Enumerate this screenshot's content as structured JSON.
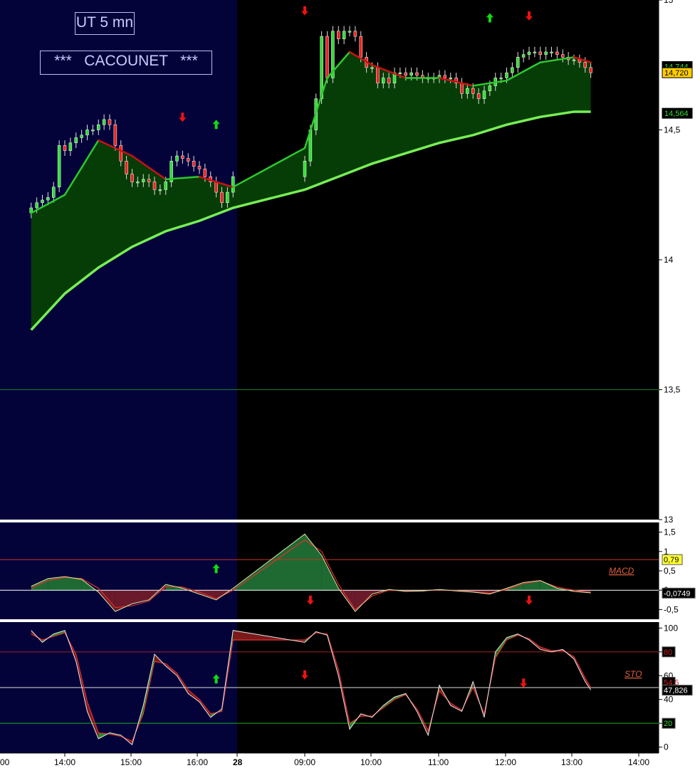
{
  "header": {
    "timeframe": "UT 5 mn",
    "author": "***   CACOUNET   ***"
  },
  "colors": {
    "prev_session_bg": "#03033a",
    "session_bg": "#000000",
    "area_fill": "#063c06",
    "ema_fast_up": "#2ec82e",
    "ema_fast_down": "#cc1111",
    "ema_slow": "#77ee55",
    "candle_up": "#33dd33",
    "candle_down": "#ee2222",
    "signal_up": "#11dd11",
    "signal_down": "#ee1111",
    "ref_line": "#1e7a1e"
  },
  "chart_data": [
    {
      "type": "candlestick",
      "name_shown": "",
      "x_axis": {
        "type": "time",
        "ticks": [
          "14:00",
          "15:00",
          "16:00",
          "28",
          "09:00",
          "10:00",
          "11:00",
          "12:00",
          "13:00",
          "14:00"
        ],
        "left_edge_label": "00"
      },
      "y_axis": {
        "side": "right",
        "range": [
          13.0,
          15.0
        ],
        "ticks": [
          "15",
          "14,5",
          "14",
          "13,5",
          "13"
        ]
      },
      "price_labels": [
        {
          "text": "14,744",
          "value": 14.744,
          "color": "#33dd33"
        },
        {
          "text": "14,720",
          "value": 14.72,
          "color": "#ffcc00"
        },
        {
          "text": "14,564",
          "value": 14.564,
          "color": "#33dd33"
        }
      ],
      "reference_line": 13.5,
      "series": [
        {
          "name": "",
          "role": "close_approx",
          "x": [
            "13:30",
            "13:35",
            "13:40",
            "13:45",
            "13:50",
            "13:55",
            "14:00",
            "14:05",
            "14:10",
            "14:15",
            "14:20",
            "14:25",
            "14:30",
            "14:35",
            "14:40",
            "14:45",
            "14:50",
            "14:55",
            "15:00",
            "15:05",
            "15:10",
            "15:15",
            "15:20",
            "15:25",
            "15:30",
            "15:35",
            "15:40",
            "15:45",
            "15:50",
            "15:55",
            "16:00",
            "16:05",
            "16:10",
            "16:15",
            "16:20",
            "16:25",
            "16:30",
            "09:00",
            "09:05",
            "09:10",
            "09:15",
            "09:20",
            "09:25",
            "09:30",
            "09:35",
            "09:40",
            "09:45",
            "09:50",
            "09:55",
            "10:00",
            "10:05",
            "10:10",
            "10:15",
            "10:20",
            "10:25",
            "10:30",
            "10:35",
            "10:40",
            "10:45",
            "10:50",
            "10:55",
            "11:00",
            "11:05",
            "11:10",
            "11:15",
            "11:20",
            "11:25",
            "11:30",
            "11:35",
            "11:40",
            "11:45",
            "11:50",
            "11:55",
            "12:00",
            "12:05",
            "12:10",
            "12:15",
            "12:20",
            "12:25",
            "12:30",
            "12:35",
            "12:40",
            "12:45",
            "12:50",
            "12:55",
            "13:00",
            "13:05",
            "13:10",
            "13:15"
          ],
          "y": [
            14.2,
            14.22,
            14.23,
            14.24,
            14.28,
            14.44,
            14.42,
            14.45,
            14.47,
            14.48,
            14.5,
            14.5,
            14.52,
            14.54,
            14.52,
            14.44,
            14.38,
            14.33,
            14.3,
            14.3,
            14.31,
            14.3,
            14.27,
            14.27,
            14.3,
            14.38,
            14.4,
            14.39,
            14.38,
            14.36,
            14.35,
            14.32,
            14.3,
            14.26,
            14.22,
            14.26,
            14.32,
            14.38,
            14.5,
            14.62,
            14.86,
            14.7,
            14.88,
            14.85,
            14.88,
            14.88,
            14.86,
            14.78,
            14.74,
            14.74,
            14.68,
            14.7,
            14.68,
            14.72,
            14.72,
            14.71,
            14.72,
            14.71,
            14.7,
            14.7,
            14.7,
            14.71,
            14.7,
            14.7,
            14.68,
            14.64,
            14.66,
            14.64,
            14.62,
            14.65,
            14.67,
            14.7,
            14.7,
            14.72,
            14.74,
            14.78,
            14.79,
            14.8,
            14.8,
            14.79,
            14.8,
            14.8,
            14.79,
            14.78,
            14.77,
            14.77,
            14.76,
            14.74,
            14.72
          ]
        },
        {
          "name": "",
          "role": "ema_fast",
          "x": [
            "13:30",
            "14:00",
            "14:30",
            "15:00",
            "15:30",
            "16:00",
            "16:30",
            "09:00",
            "09:20",
            "09:40",
            "10:00",
            "10:30",
            "11:00",
            "11:30",
            "12:00",
            "12:30",
            "13:00",
            "13:15"
          ],
          "y": [
            14.18,
            14.25,
            14.46,
            14.4,
            14.31,
            14.32,
            14.28,
            14.43,
            14.7,
            14.8,
            14.75,
            14.7,
            14.7,
            14.67,
            14.69,
            14.76,
            14.78,
            14.76
          ]
        },
        {
          "name": "",
          "role": "ema_slow",
          "x": [
            "13:30",
            "14:00",
            "14:30",
            "15:00",
            "15:30",
            "16:00",
            "16:30",
            "09:00",
            "09:30",
            "10:00",
            "10:30",
            "11:00",
            "11:30",
            "12:00",
            "12:30",
            "13:00",
            "13:15"
          ],
          "y": [
            13.73,
            13.87,
            13.97,
            14.05,
            14.11,
            14.15,
            14.2,
            14.27,
            14.32,
            14.37,
            14.41,
            14.45,
            14.48,
            14.52,
            14.55,
            14.57,
            14.57
          ]
        }
      ],
      "signals": [
        {
          "dir": "down",
          "at": "15:45",
          "value": 14.55
        },
        {
          "dir": "up",
          "at": "16:15",
          "value": 14.52
        },
        {
          "dir": "down",
          "at": "09:00",
          "value": 14.96
        },
        {
          "dir": "up",
          "at": "11:45",
          "value": 14.93
        },
        {
          "dir": "down",
          "at": "12:20",
          "value": 14.94
        }
      ]
    },
    {
      "type": "area",
      "title": "MACD",
      "y_axis": {
        "side": "right",
        "range": [
          -0.75,
          1.75
        ],
        "ticks": [
          "1,5",
          "1",
          "0,5",
          "0",
          "-0,5"
        ]
      },
      "levels": [
        0.79,
        0
      ],
      "value_labels": [
        {
          "text": "0,79",
          "value": 0.79,
          "color": "#ffff33"
        },
        {
          "text": "-0,0749",
          "value": -0.0749,
          "color": "#000000"
        }
      ],
      "series": [
        {
          "name": "",
          "role": "macd",
          "x": [
            "13:30",
            "13:45",
            "14:00",
            "14:15",
            "14:30",
            "14:45",
            "15:00",
            "15:15",
            "15:30",
            "15:45",
            "16:00",
            "16:15",
            "16:30",
            "09:00",
            "09:15",
            "09:30",
            "09:45",
            "10:00",
            "10:15",
            "10:30",
            "10:45",
            "11:00",
            "11:15",
            "11:30",
            "11:45",
            "12:00",
            "12:15",
            "12:30",
            "12:45",
            "13:00",
            "13:15"
          ],
          "y": [
            0.1,
            0.3,
            0.35,
            0.28,
            -0.05,
            -0.55,
            -0.35,
            -0.25,
            0.15,
            0.05,
            -0.1,
            -0.25,
            0.05,
            1.45,
            0.9,
            0.05,
            -0.55,
            -0.1,
            0.02,
            -0.03,
            -0.02,
            0.02,
            -0.02,
            -0.05,
            -0.1,
            0.05,
            0.2,
            0.25,
            0.05,
            -0.03,
            -0.07
          ]
        },
        {
          "name": "",
          "role": "signal",
          "x": [
            "13:30",
            "13:45",
            "14:00",
            "14:15",
            "14:30",
            "14:45",
            "15:00",
            "15:15",
            "15:30",
            "15:45",
            "16:00",
            "16:15",
            "16:30",
            "09:00",
            "09:15",
            "09:30",
            "09:45",
            "10:00",
            "10:15",
            "10:30",
            "10:45",
            "11:00",
            "11:15",
            "11:30",
            "11:45",
            "12:00",
            "12:15",
            "12:30",
            "12:45",
            "13:00",
            "13:15"
          ],
          "y": [
            0.05,
            0.25,
            0.33,
            0.3,
            0.05,
            -0.45,
            -0.4,
            -0.28,
            0.1,
            0.08,
            -0.05,
            -0.22,
            0.0,
            1.3,
            1.0,
            0.15,
            -0.5,
            -0.15,
            0.0,
            -0.02,
            -0.02,
            0.01,
            -0.01,
            -0.04,
            -0.08,
            0.02,
            0.17,
            0.24,
            0.08,
            0.0,
            -0.06
          ]
        }
      ],
      "signals": [
        {
          "dir": "up",
          "at": "16:15",
          "value": 0.55
        },
        {
          "dir": "down",
          "at": "09:05",
          "value": -0.25
        },
        {
          "dir": "down",
          "at": "12:20",
          "value": -0.25
        }
      ]
    },
    {
      "type": "area",
      "title": "STO",
      "y_axis": {
        "side": "right",
        "range": [
          -5,
          105
        ],
        "ticks": [
          "100",
          "80",
          "60",
          "40",
          "20",
          "0"
        ]
      },
      "levels": [
        80,
        50,
        20
      ],
      "value_labels": [
        {
          "text": "80",
          "value": 80,
          "color": "#cc2222"
        },
        {
          "text": "54,5",
          "value": 54.5,
          "color": "#cc2222"
        },
        {
          "text": "47,826",
          "value": 47.826,
          "color": "#000000"
        },
        {
          "text": "20",
          "value": 20,
          "color": "#33dd33"
        }
      ],
      "series": [
        {
          "name": "",
          "role": "k",
          "x": [
            "13:30",
            "13:40",
            "13:50",
            "14:00",
            "14:10",
            "14:20",
            "14:30",
            "14:40",
            "14:50",
            "15:00",
            "15:10",
            "15:20",
            "15:30",
            "15:40",
            "15:50",
            "16:00",
            "16:10",
            "16:20",
            "16:30",
            "09:00",
            "09:10",
            "09:20",
            "09:30",
            "09:40",
            "09:50",
            "10:00",
            "10:10",
            "10:20",
            "10:30",
            "10:40",
            "10:50",
            "11:00",
            "11:10",
            "11:20",
            "11:30",
            "11:40",
            "11:50",
            "12:00",
            "12:10",
            "12:20",
            "12:30",
            "12:40",
            "12:50",
            "13:00",
            "13:10",
            "13:15"
          ],
          "y": [
            98,
            88,
            95,
            98,
            72,
            30,
            7,
            12,
            10,
            2,
            35,
            78,
            68,
            60,
            45,
            38,
            25,
            32,
            98,
            88,
            97,
            94,
            60,
            15,
            28,
            25,
            35,
            42,
            45,
            30,
            10,
            52,
            35,
            30,
            55,
            25,
            80,
            92,
            95,
            90,
            82,
            80,
            82,
            74,
            55,
            48
          ]
        },
        {
          "name": "",
          "role": "d",
          "x": [
            "13:30",
            "13:40",
            "13:50",
            "14:00",
            "14:10",
            "14:20",
            "14:30",
            "14:40",
            "14:50",
            "15:00",
            "15:10",
            "15:20",
            "15:30",
            "15:40",
            "15:50",
            "16:00",
            "16:10",
            "16:20",
            "16:30",
            "09:00",
            "09:10",
            "09:20",
            "09:30",
            "09:40",
            "09:50",
            "10:00",
            "10:10",
            "10:20",
            "10:30",
            "10:40",
            "10:50",
            "11:00",
            "11:10",
            "11:20",
            "11:30",
            "11:40",
            "11:50",
            "12:00",
            "12:10",
            "12:20",
            "12:30",
            "12:40",
            "12:50",
            "13:00",
            "13:10",
            "13:15"
          ],
          "y": [
            95,
            90,
            93,
            96,
            78,
            38,
            12,
            11,
            9,
            5,
            28,
            72,
            70,
            62,
            48,
            40,
            28,
            30,
            90,
            90,
            96,
            95,
            65,
            20,
            26,
            26,
            33,
            40,
            44,
            32,
            14,
            47,
            37,
            31,
            50,
            28,
            75,
            90,
            94,
            91,
            84,
            81,
            81,
            76,
            58,
            50
          ]
        }
      ],
      "signals": [
        {
          "dir": "up",
          "at": "16:15",
          "value": 57
        },
        {
          "dir": "down",
          "at": "09:00",
          "value": 61
        },
        {
          "dir": "down",
          "at": "12:15",
          "value": 54
        }
      ]
    }
  ]
}
